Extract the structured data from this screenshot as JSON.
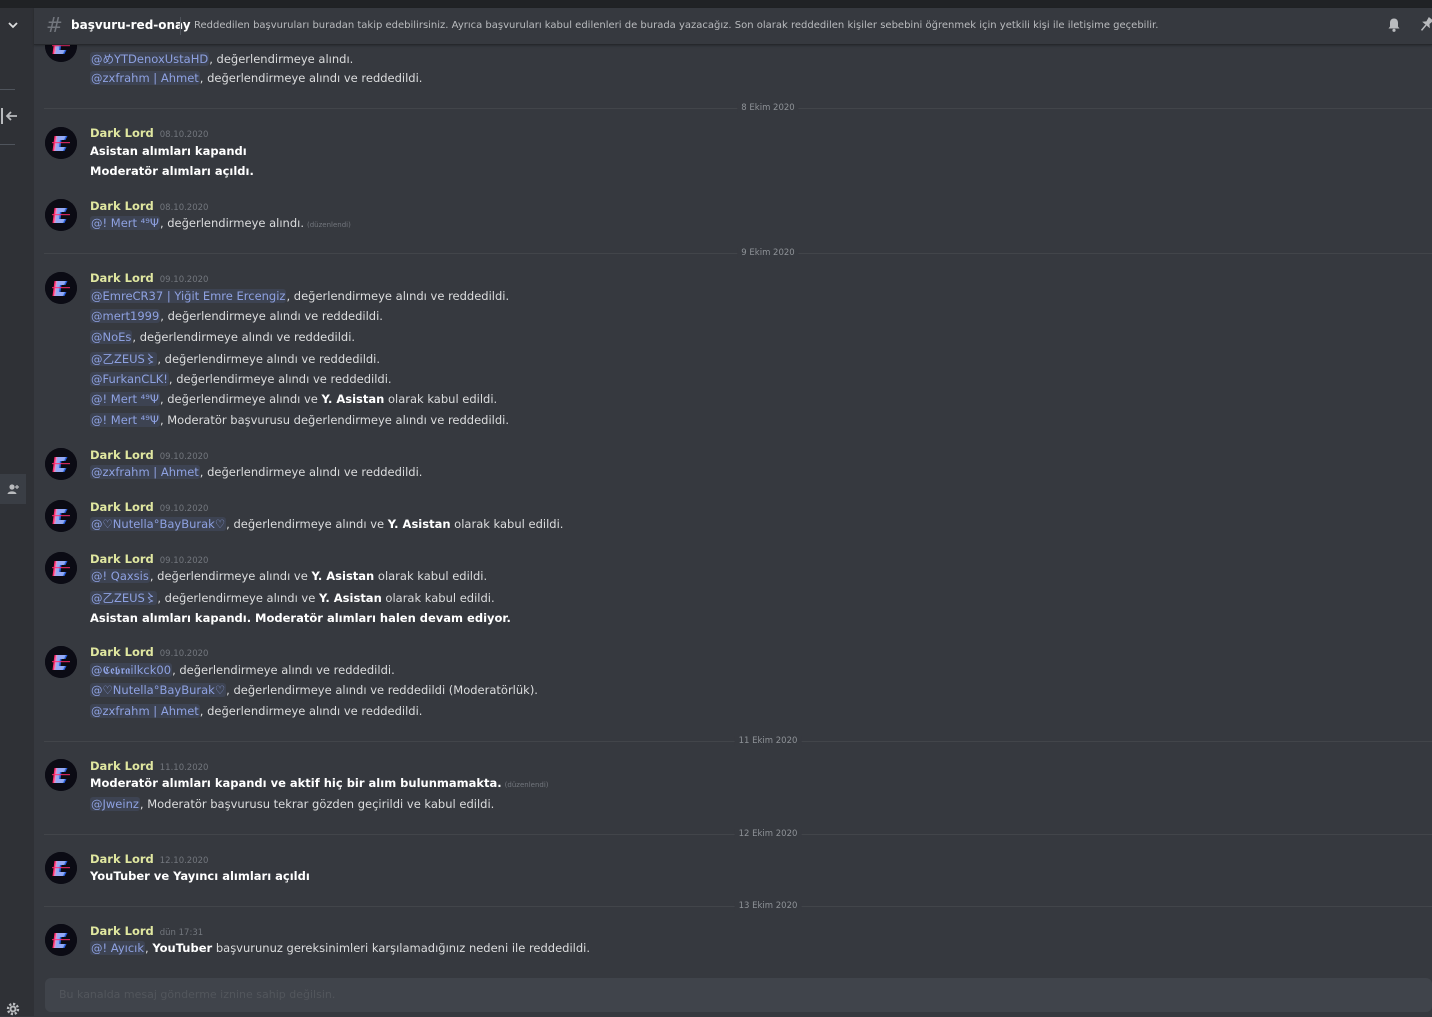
{
  "channel": {
    "name": "başvuru-red-onay",
    "topic": "Reddedilen başvuruları buradan takip edebilirsiniz. Ayrıca başvuruları kabul edilenleri de burada yazacağız. Son olarak reddedilen kişiler sebebini öğrenmek için yetkili kişi ile iletişime geçebilir."
  },
  "icons": {
    "channel": "hash-icon",
    "notifications": "bell-icon",
    "pins": "pin-icon",
    "settings": "gear-icon",
    "collapse": "arrow-left-icon",
    "members": "person-add-icon",
    "server_menu": "chevron-down-icon"
  },
  "colors": {
    "author": "#e0e7a0",
    "mention": "#8ea1e1",
    "background": "#36393f"
  },
  "common": {
    "author": "Dark Lord",
    "edited": "(düzenlendi)",
    "and": " ve "
  },
  "top": {
    "l1_mention": "@めYTDenoxUstaHD",
    "l1_text": ", değerlendirmeye alındı.",
    "l2_mention": "@zxfrahm | Ahmet",
    "l2_text": ", değerlendirmeye alındı ve reddedildi."
  },
  "dates": [
    "8 Ekim 2020",
    "9 Ekim 2020",
    "11 Ekim 2020",
    "12 Ekim 2020",
    "13 Ekim 2020"
  ],
  "m1": {
    "ts": "08.10.2020",
    "l1": "Asistan alımları kapandı",
    "l2": "Moderatör alımları açıldı."
  },
  "m2": {
    "ts": "08.10.2020",
    "mention": "@! Mert ⁴⁹Ψ",
    "text": ", değerlendirmeye alındı."
  },
  "m3": {
    "ts": "09.10.2020",
    "lines": [
      {
        "mention": "@EmreCR37 | Yiğit Emre Ercengiz",
        "text": ", değerlendirmeye alındı ve reddedildi."
      },
      {
        "mention": "@mert1999",
        "text": ", değerlendirmeye alındı ve reddedildi."
      },
      {
        "mention": "@NoEs",
        "text": ", değerlendirmeye alındı ve reddedildi."
      },
      {
        "mention": "@乙ZEUS〻",
        "text": ", değerlendirmeye alındı ve reddedildi."
      },
      {
        "mention": "@FurkanCLK!",
        "text": ", değerlendirmeye alındı ve reddedildi."
      }
    ],
    "l6_mention": "@! Mert ⁴⁹Ψ",
    "l6_pre": ", değerlendirmeye alındı ve ",
    "l6_bold": "Y. Asistan",
    "l6_post": " olarak kabul edildi.",
    "l7_mention": "@! Mert ⁴⁹Ψ",
    "l7_text": ", Moderatör başvurusu değerlendirmeye alındı ve reddedildi."
  },
  "m4": {
    "ts": "09.10.2020",
    "mention": "@zxfrahm | Ahmet",
    "text": ", değerlendirmeye alındı ve reddedildi."
  },
  "m5": {
    "ts": "09.10.2020",
    "mention": "@♡Nutella°BayBurak♡",
    "pre": ", değerlendirmeye alındı ve ",
    "bold": "Y. Asistan",
    "post": " olarak kabul edildi."
  },
  "m6": {
    "ts": "09.10.2020",
    "l1_mention": "@! Qaxsis",
    "l1_pre": ", değerlendirmeye alındı ve ",
    "l1_bold": "Y. Asistan",
    "l1_post": " olarak kabul edildi.",
    "l2_mention": "@乙ZEUS〻",
    "l2_pre": ", değerlendirmeye alındı ve ",
    "l2_bold": "Y. Asistan",
    "l2_post": " olarak kabul edildi.",
    "l3": "Asistan alımları kapandı. Moderatör alımları halen devam ediyor."
  },
  "m7": {
    "ts": "09.10.2020",
    "lines": [
      {
        "mention": "@𝕮𝖊𝖇𝖗𝖆ilkck00",
        "text": ", değerlendirmeye alındı ve reddedildi."
      },
      {
        "mention": "@♡Nutella°BayBurak♡",
        "text": ", değerlendirmeye alındı ve reddedildi (Moderatörlük)."
      },
      {
        "mention": "@zxfrahm | Ahmet",
        "text": ", değerlendirmeye alındı ve reddedildi."
      }
    ]
  },
  "m8": {
    "ts": "11.10.2020",
    "l1": "Moderatör alımları kapandı ve aktif hiç bir alım bulunmamakta.",
    "l2_mention": "@Jweinz",
    "l2_text": ", Moderatör başvurusu tekrar gözden geçirildi ve kabul edildi."
  },
  "m9": {
    "ts": "12.10.2020",
    "l1": "YouTuber ve Yayıncı alımları açıldı"
  },
  "m10": {
    "ts": "dün 17:31",
    "mention": "@! Ayıcık",
    "bold": "YouTuber",
    "text": " başvurunuz gereksinimleri karşılamadığınız nedeni ile reddedildi."
  },
  "input": {
    "placeholder": "Bu kanalda mesaj gönderme iznine sahip değilsin."
  }
}
